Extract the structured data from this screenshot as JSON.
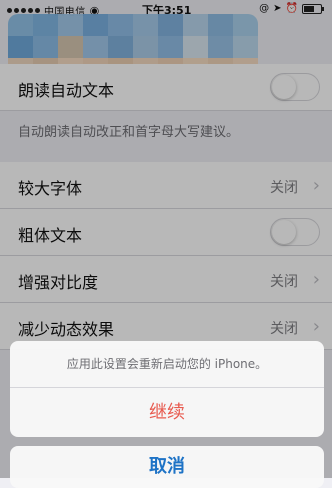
{
  "status_bar": {
    "carrier": "中国电信",
    "time": "下午3:51"
  },
  "settings": {
    "speak_auto_text": {
      "label": "朗读自动文本",
      "description": "自动朗读自动改正和首字母大写建议。"
    },
    "rows": [
      {
        "label": "较大字体",
        "value": "关闭"
      },
      {
        "label": "粗体文本"
      },
      {
        "label": "增强对比度",
        "value": "关闭"
      },
      {
        "label": "减少动态效果",
        "value": "关闭"
      }
    ]
  },
  "action_sheet": {
    "message": "应用此设置会重新启动您的 iPhone。",
    "continue_label": "继续",
    "cancel_label": "取消"
  },
  "colors": {
    "continue_text": "#e85a4f",
    "cancel_text": "#1e73c6",
    "background": "#efeff4"
  }
}
